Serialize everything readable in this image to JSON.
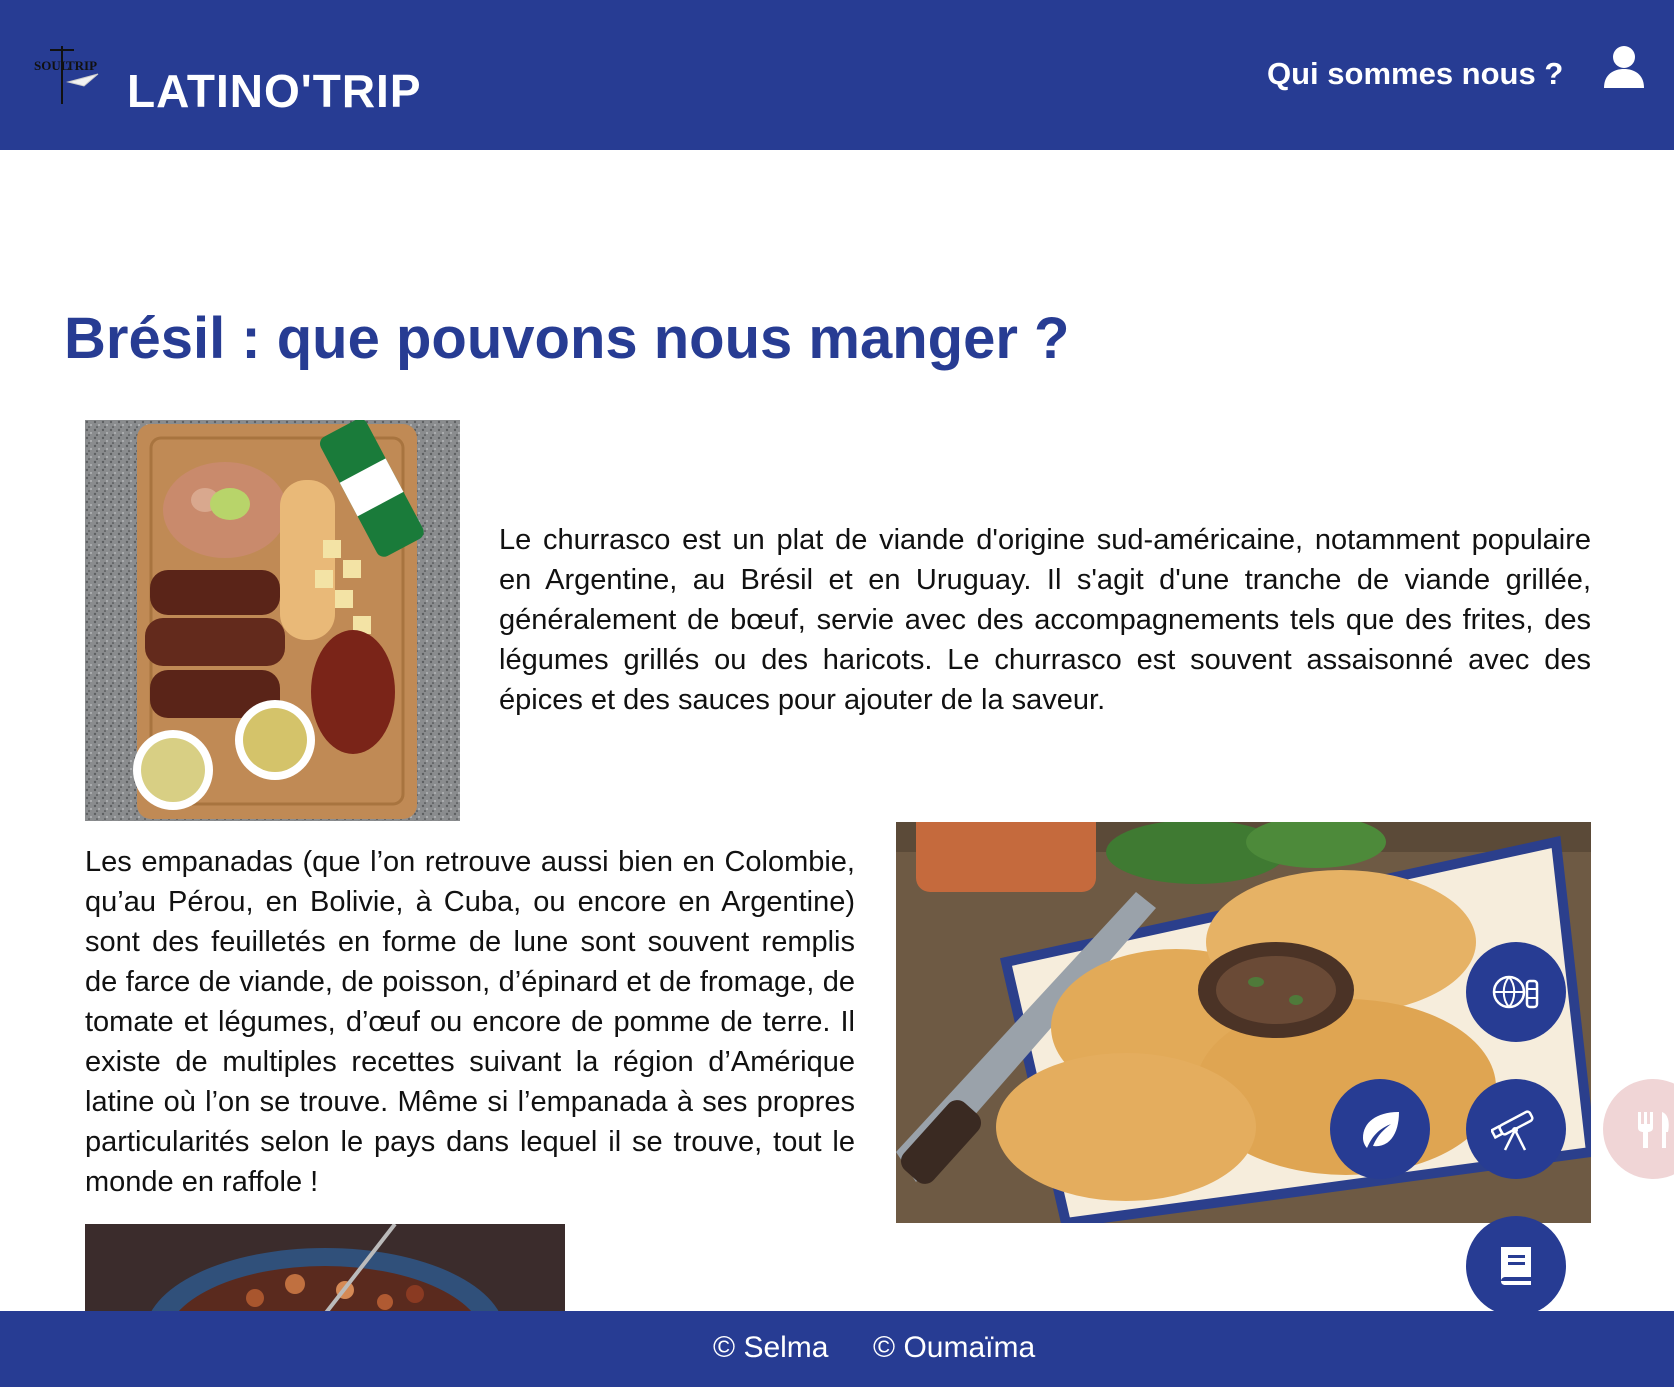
{
  "header": {
    "brand": "LATINO'TRIP",
    "logo_text": "SOUL TRIP",
    "nav_link": "Qui sommes nous ?",
    "user_icon": "user-icon"
  },
  "main": {
    "title": "Brésil : que pouvons nous manger ?",
    "paragraphs": [
      "Le churrasco est un plat de viande d'origine sud-américaine, notamment populaire en Argentine, au Brésil et en Uruguay. Il s'agit d'une tranche de viande grillée, généralement de bœuf, servie avec des accompagnements tels que des frites, des légumes grillés ou des haricots. Le churrasco est souvent assaisonné avec des épices et des sauces pour ajouter de la saveur.",
      "Les empanadas (que l’on retrouve aussi bien en Colombie, qu’au Pérou, en Bolivie, à Cuba, ou encore en Argentine) sont des feuilletés en forme de lune sont souvent remplis de farce de viande, de poisson, d’épinard et de fromage, de tomate et légumes, d’œuf ou encore de pomme de terre. Il existe de multiples recettes suivant la région d’Amérique latine où l’on se trouve. Même si l’empanada à ses propres particularités selon le pays dans lequel il se trouve, tout le monde en raffole !"
    ],
    "images": [
      "churrasco-photo",
      "empanadas-photo",
      "feijoada-photo"
    ]
  },
  "fabs": {
    "icons": [
      "sport-icon",
      "leaf-icon",
      "telescope-icon",
      "book-icon",
      "food-icon"
    ]
  },
  "footer": {
    "credits": [
      "© Selma",
      "© Oumaïma"
    ]
  },
  "colors": {
    "primary": "#273c93",
    "text": "#111111",
    "food_fab": "#f0d5d6"
  }
}
